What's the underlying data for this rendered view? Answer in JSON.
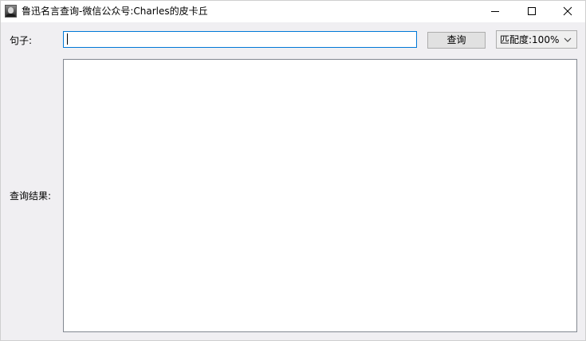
{
  "window": {
    "title": "鲁迅名言查询-微信公众号:Charles的皮卡丘",
    "icon": "portrait-icon",
    "controls": [
      "minimize-icon",
      "maximize-icon",
      "close-icon"
    ]
  },
  "form": {
    "sentence_label": "句子:",
    "sentence_value": "",
    "query_button_label": "查询",
    "match_select": {
      "label": "匹配度:",
      "value": "100%"
    },
    "result_label": "查询结果:",
    "result_value": ""
  },
  "colors": {
    "window_background": "#f0eff2",
    "titlebar_background": "#ffffff",
    "input_focus_border": "#0078d7",
    "button_background": "#e1e1e1",
    "button_border": "#adadad",
    "textarea_border": "#828790"
  }
}
